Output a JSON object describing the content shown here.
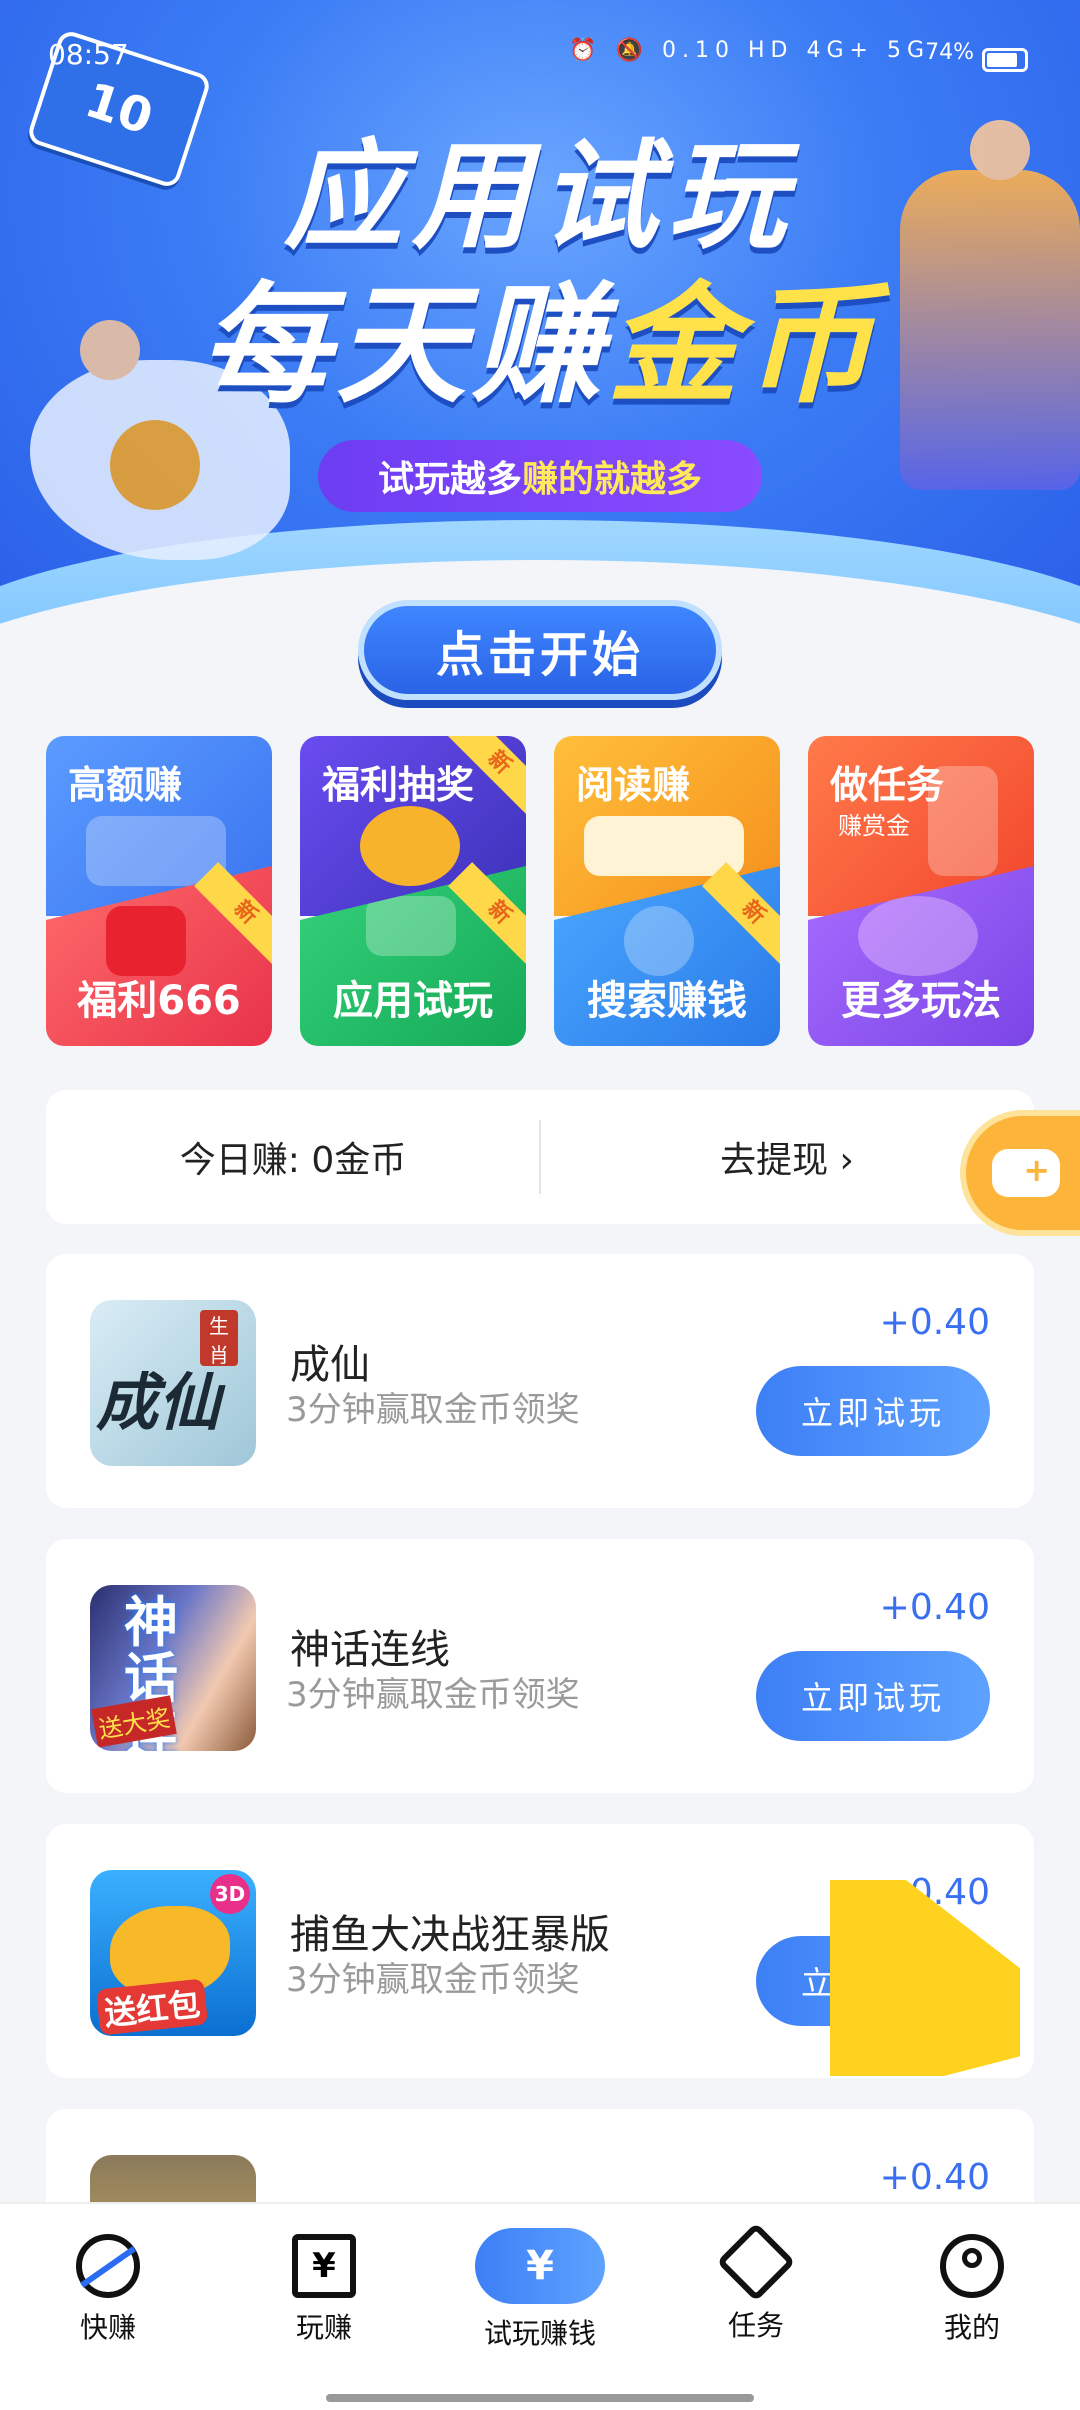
{
  "status_bar": {
    "time": "08:57",
    "icons_text": "⏰ 🔕 0.10 HD 4G+ 5G",
    "battery": "74%"
  },
  "hero": {
    "ticket_number": "10",
    "title_line1": "应用试玩",
    "title_line2_white": "每天赚",
    "title_line2_gold": "金币",
    "slogan_prefix": "试玩越多",
    "slogan_highlight": "赚的就越多",
    "start_button": "点击开始"
  },
  "features": [
    {
      "top_label": "高额赚",
      "top_sub": "",
      "bottom_label": "福利666",
      "new": true,
      "top_color": "#4d8bf7",
      "bottom_color": "#f54b52"
    },
    {
      "top_label": "福利抽奖",
      "top_sub": "",
      "bottom_label": "应用试玩",
      "new": true,
      "top_color": "#5a48d8",
      "bottom_color": "#2cc36b"
    },
    {
      "top_label": "阅读赚",
      "top_sub": "",
      "bottom_label": "搜索赚钱",
      "new": true,
      "top_color": "#f7a12c",
      "bottom_color": "#3a98ff"
    },
    {
      "top_label": "做任务",
      "top_sub": "赚赏金",
      "bottom_label": "更多玩法",
      "new": false,
      "top_color": "#ff6a3a",
      "bottom_color": "#9a5cf0"
    }
  ],
  "feature_new_tag": "新",
  "feature_top_sub_1": "",
  "earnings": {
    "today_label": "今日赚: 0金币",
    "withdraw_label": "去提现 ›"
  },
  "apps": [
    {
      "name": "成仙",
      "desc": "3分钟赢取金币领奖",
      "reward": "+0.40",
      "button": "立即试玩",
      "icon_text": "成仙",
      "icon_badge": "生肖"
    },
    {
      "name": "神话连线",
      "desc": "3分钟赢取金币领奖",
      "reward": "+0.40",
      "button": "立即试玩",
      "icon_text": "神话连线",
      "icon_badge": "送大奖"
    },
    {
      "name": "捕鱼大决战狂暴版",
      "desc": "3分钟赢取金币领奖",
      "reward": "+0.40",
      "button": "立即试玩",
      "icon_text": "送红包",
      "icon_badge": "3D"
    },
    {
      "name": "",
      "desc": "",
      "reward": "+0.40",
      "button": "",
      "icon_text": "",
      "icon_badge": ""
    }
  ],
  "nav": [
    {
      "label": "快赚",
      "icon": "quick-earn-icon",
      "active": false
    },
    {
      "label": "玩赚",
      "icon": "yuan-cards-icon",
      "active": false
    },
    {
      "label": "试玩赚钱",
      "icon": "money-bag-icon",
      "active": true
    },
    {
      "label": "任务",
      "icon": "task-diamond-icon",
      "active": false
    },
    {
      "label": "我的",
      "icon": "profile-icon",
      "active": false
    }
  ],
  "colors": {
    "accent": "#3d7ff6",
    "reward": "#3a6ff0",
    "gold": "#ffe24a"
  }
}
